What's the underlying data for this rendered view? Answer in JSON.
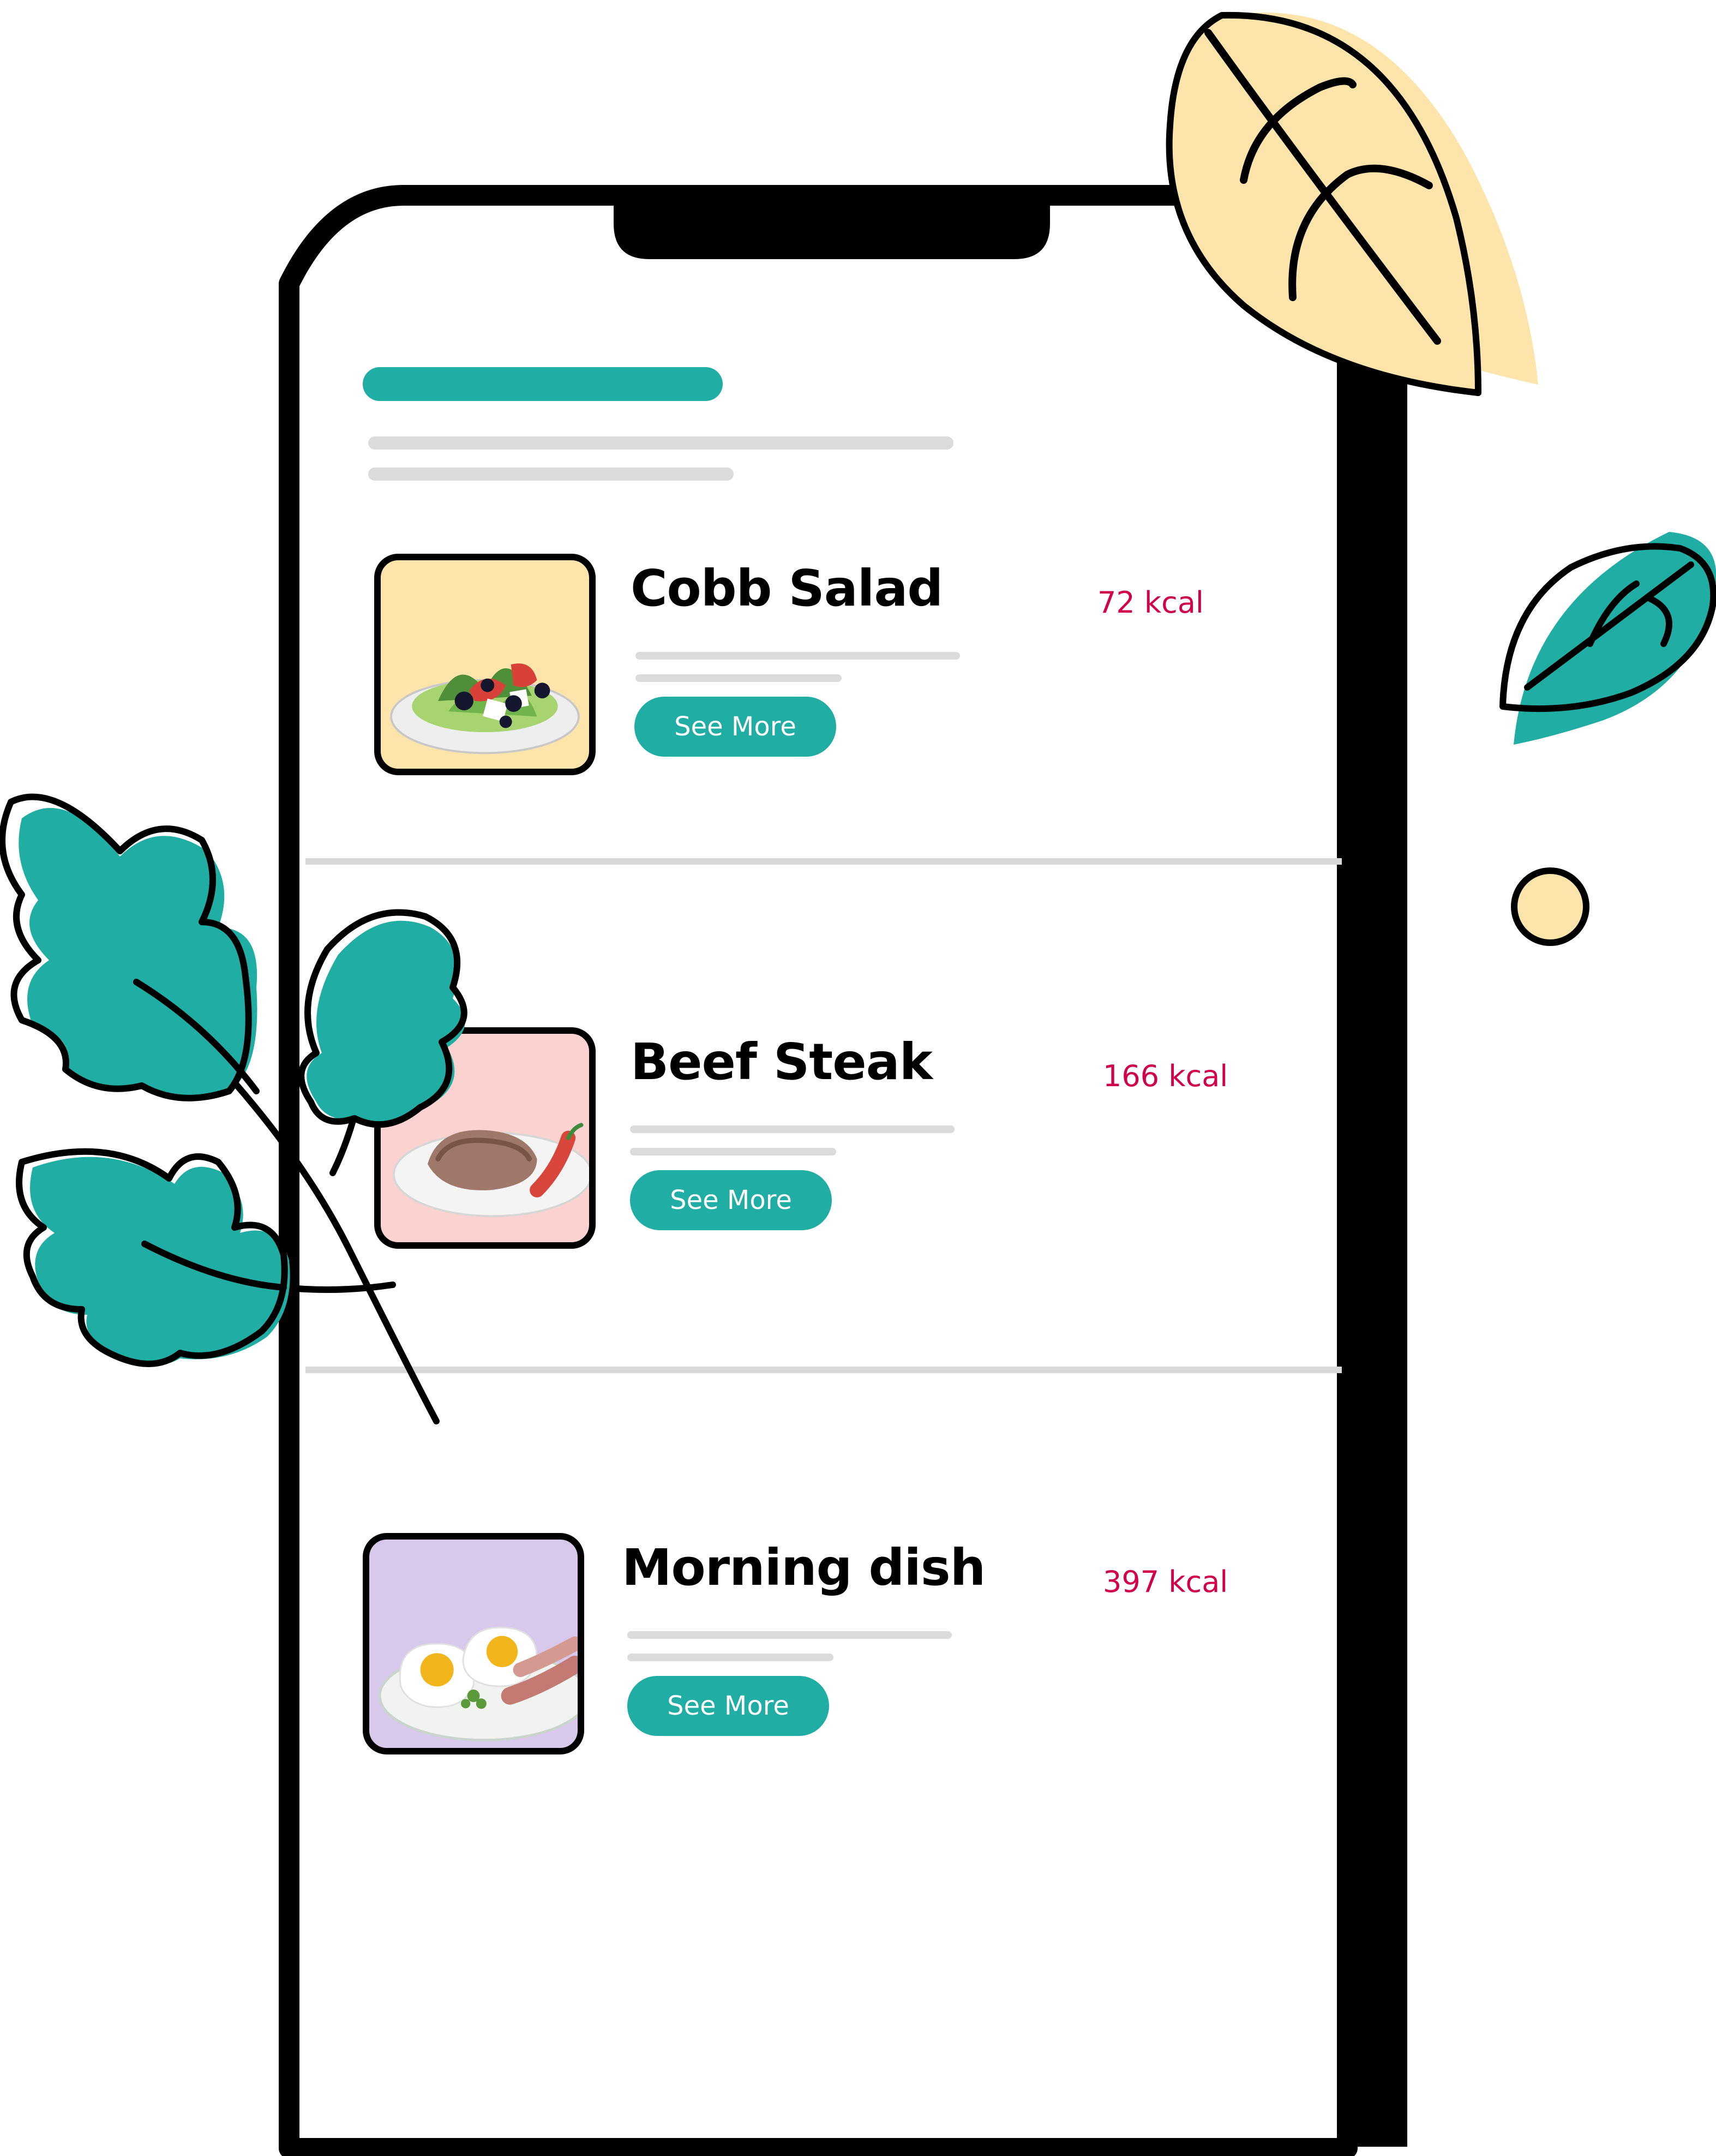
{
  "theme": {
    "accent": "#20ada4",
    "kcal_color": "#d0004a",
    "leaf_teal": "#20ada4",
    "leaf_yellow": "#fde4ab",
    "salad_bg": "#fde4ab",
    "steak_bg": "#fbd2cf",
    "morning_bg": "#d7c8ec"
  },
  "decorations": {
    "yellow_leaf": "leaf-icon",
    "teal_leaf": "leaf-icon",
    "yellow_dot": "dot-icon",
    "parsley_branch": "parsley-icon"
  },
  "meals": [
    {
      "name": "Cobb Salad",
      "kcal": "72 kcal",
      "button": "See More",
      "image_icon": "salad-icon"
    },
    {
      "name": "Beef Steak",
      "kcal": "166 kcal",
      "button": "See More",
      "image_icon": "steak-icon"
    },
    {
      "name": "Morning dish",
      "kcal": "397 kcal",
      "button": "See More",
      "image_icon": "eggs-icon"
    }
  ]
}
